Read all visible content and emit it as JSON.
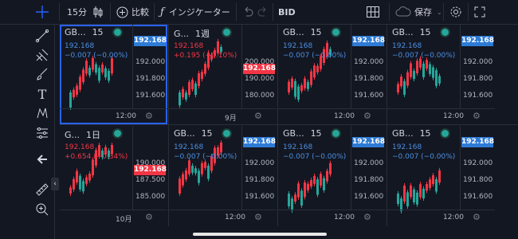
{
  "toolbar": {
    "interval": "15分",
    "compare_label": "比較",
    "indicator_label": "インジケーター",
    "price_source": "BID",
    "save_label": "保存"
  },
  "colors": {
    "accent": "#2962ff",
    "up": "#26a69a",
    "down": "#f23645",
    "bg": "#131722",
    "price_tag": "#2e7bd6"
  },
  "panels": [
    {
      "title": "GB...",
      "tf": "15",
      "price": "192.168",
      "change": "−0.007 (−0.00%)",
      "change_color": "blue",
      "ticks": [
        "192.000",
        "191.800",
        "191.600"
      ],
      "tag": "192.168",
      "tag_color": "blue",
      "xlabel": "12:00",
      "active": true
    },
    {
      "title": "G...",
      "tf": "1週",
      "price": "192.168",
      "change": "+0.195 (+0.10%)",
      "change_color": "red",
      "ticks": [
        "200.000",
        "190.000",
        "180.000"
      ],
      "tag": "192.168",
      "tag_color": "red",
      "xlabel": "9月",
      "active": false
    },
    {
      "title": "GB...",
      "tf": "15",
      "price": "192.168",
      "change": "−0.007 (−0.00%)",
      "change_color": "blue",
      "ticks": [
        "192.000",
        "191.800",
        "191.600"
      ],
      "tag": "192.168",
      "tag_color": "blue",
      "xlabel": "12:00",
      "active": false
    },
    {
      "title": "GB...",
      "tf": "15",
      "price": "192.168",
      "change": "−0.007 (−0.00%)",
      "change_color": "blue",
      "ticks": [
        "192.000",
        "191.800",
        "191.600"
      ],
      "tag": "192.168",
      "tag_color": "blue",
      "xlabel": "12:00",
      "active": false
    },
    {
      "title": "G...",
      "tf": "1日",
      "price": "192.168",
      "change": "+0.654 (+0.34%)",
      "change_color": "red",
      "ticks": [
        "190.000",
        "187.500",
        "185.000"
      ],
      "tag": "192.168",
      "tag_color": "red",
      "xlabel": "10月",
      "active": false
    },
    {
      "title": "GB...",
      "tf": "15",
      "price": "192.168",
      "change": "−0.007 (−0.00%)",
      "change_color": "blue",
      "ticks": [
        "192.000",
        "191.800",
        "191.600"
      ],
      "tag": "192.168",
      "tag_color": "blue",
      "xlabel": "12:00",
      "active": false
    },
    {
      "title": "GB...",
      "tf": "15",
      "price": "192.168",
      "change": "−0.007 (−0.00%)",
      "change_color": "blue",
      "ticks": [
        "192.000",
        "191.800",
        "191.600"
      ],
      "tag": "192.168",
      "tag_color": "blue",
      "xlabel": "12:00",
      "active": false
    },
    {
      "title": "GB...",
      "tf": "15",
      "price": "192.168",
      "change": "−0.007 (−0.00%)",
      "change_color": "blue",
      "ticks": [
        "192.000",
        "191.800",
        "191.600"
      ],
      "tag": "192.168",
      "tag_color": "blue",
      "xlabel": "12:00",
      "active": false
    }
  ]
}
